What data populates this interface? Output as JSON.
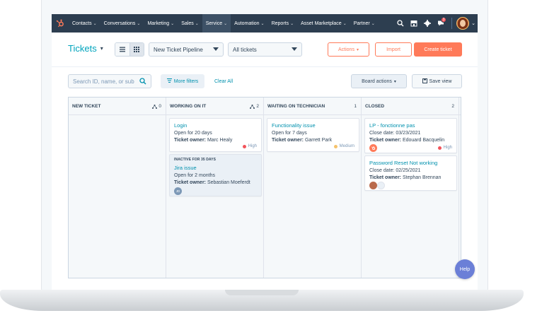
{
  "nav": {
    "items": [
      {
        "label": "Contacts"
      },
      {
        "label": "Conversations"
      },
      {
        "label": "Marketing"
      },
      {
        "label": "Sales"
      },
      {
        "label": "Service"
      },
      {
        "label": "Automation"
      },
      {
        "label": "Reports"
      },
      {
        "label": "Asset Marketplace"
      },
      {
        "label": "Partner"
      }
    ],
    "notification_count": "3"
  },
  "header": {
    "title": "Tickets",
    "pipeline": "New Ticket Pipeline",
    "view": "All tickets",
    "actions_label": "Actions",
    "import_label": "Import",
    "create_label": "Create ticket"
  },
  "filters": {
    "search_placeholder": "Search ID, name, or sub",
    "more_filters_label": "More filters",
    "clear_all_label": "Clear All",
    "board_actions_label": "Board actions",
    "save_view_label": "Save view"
  },
  "board": {
    "columns": [
      {
        "name": "NEW TICKET",
        "count": "0"
      },
      {
        "name": "WORKING ON IT",
        "count": "2"
      },
      {
        "name": "WAITING ON TECHNICIAN",
        "count": "1"
      },
      {
        "name": "CLOSED",
        "count": "2"
      }
    ],
    "cards": {
      "login": {
        "title": "Login",
        "line1": "Open for 20 days",
        "owner_label": "Ticket owner:",
        "owner": "Marc Healy",
        "priority": "High"
      },
      "jira": {
        "inactive": "INACTIVE FOR 35 DAYS",
        "title": "Jira issue",
        "line1": "Open for 2 months",
        "owner_label": "Ticket owner:",
        "owner": "Sebastian Moeferdt",
        "avatar_initials": "JD"
      },
      "functionality": {
        "title": "Functionality issue",
        "line1": "Open for 7 days",
        "owner_label": "Ticket owner:",
        "owner": "Garrett Park",
        "priority": "Medium"
      },
      "lp": {
        "title": "LP - fonctionne pas",
        "line1": "Close date: 03/23/2021",
        "owner_label": "Ticket owner:",
        "owner": "Edouard Bacquelin",
        "priority": "High"
      },
      "password": {
        "title": "Password Reset Not working",
        "line1": "Close date: 02/25/2021",
        "owner_label": "Ticket owner:",
        "owner": "Stephan Brennan"
      }
    }
  },
  "help_label": "Help",
  "colors": {
    "nav_bg": "#2d3e50",
    "accent_orange": "#ff7a59",
    "link_teal": "#0091ae",
    "high": "#f2545b",
    "medium": "#f5c26b"
  }
}
